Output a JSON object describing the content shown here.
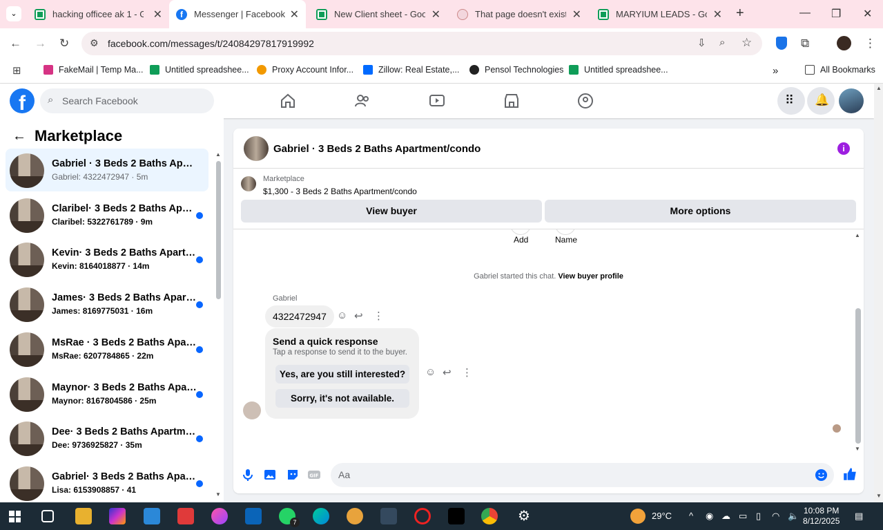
{
  "browser": {
    "tabs": [
      {
        "title": "hacking officee ak 1 - Go",
        "icon": "sheets-icon"
      },
      {
        "title": "Messenger | Facebook",
        "icon": "facebook-icon",
        "active": true
      },
      {
        "title": "New Client sheet - Googl",
        "icon": "sheets-icon"
      },
      {
        "title": "That page doesn't exist (",
        "icon": "page-icon"
      },
      {
        "title": "MARYIUM LEADS - Goog",
        "icon": "sheets-icon"
      }
    ],
    "url": "facebook.com/messages/t/24084297817919992",
    "bookmarks": [
      {
        "label": "FakeMail | Temp Ma...",
        "icon": "fakemail-icon"
      },
      {
        "label": "Untitled spreadshee...",
        "icon": "sheets-icon"
      },
      {
        "label": "Proxy Account Infor...",
        "icon": "proxy-icon"
      },
      {
        "label": "Zillow: Real Estate,...",
        "icon": "zillow-icon"
      },
      {
        "label": "Pensol Technologies",
        "icon": "pensol-icon"
      },
      {
        "label": "Untitled spreadshee...",
        "icon": "sheets-icon"
      }
    ],
    "all_bookmarks": "All Bookmarks",
    "more_bookmarks": "»"
  },
  "facebook": {
    "search_placeholder": "Search Facebook",
    "logo_letter": "f"
  },
  "sidebar": {
    "title": "Marketplace",
    "conversations": [
      {
        "name": "Gabriel · 3 Beds 2 Baths Apartm...",
        "preview": "Gabriel: 4322472947 · 5m",
        "unread": false,
        "selected": true
      },
      {
        "name": "Claribel· 3 Beds 2 Baths Apart...",
        "preview": "Claribel: 5322761789 · 9m",
        "unread": true
      },
      {
        "name": "Kevin· 3 Beds 2 Baths Apartm...",
        "preview": "Kevin: 8164018877 · 14m",
        "unread": true
      },
      {
        "name": "James· 3 Beds 2 Baths Apartm...",
        "preview": "James: 8169775031 · 16m",
        "unread": true
      },
      {
        "name": "MsRae · 3 Beds 2 Baths Apart...",
        "preview": "MsRae: 6207784865 · 22m",
        "unread": true
      },
      {
        "name": "Maynor· 3 Beds 2 Baths Apart...",
        "preview": "Maynor: 8167804586 · 25m",
        "unread": true
      },
      {
        "name": "Dee· 3 Beds 2 Baths Apartmen...",
        "preview": "Dee: 9736925827 · 35m",
        "unread": true
      },
      {
        "name": "Gabriel· 3 Beds 2 Baths Apart...",
        "preview": "Lisa: 6153908857 · 41",
        "unread": true
      }
    ]
  },
  "chat": {
    "title": "Gabriel · 3 Beds 2 Baths Apartment/condo",
    "listing_label": "Marketplace",
    "listing_price": "$1,300 - 3 Beds 2 Baths Apartment/condo",
    "view_buyer": "View buyer",
    "more_options": "More options",
    "add_label": "Add",
    "name_label": "Name",
    "started_text": "Gabriel started this chat.",
    "view_profile": "View buyer profile",
    "sender": "Gabriel",
    "message": "4322472947",
    "quick_title": "Send a quick response",
    "quick_sub": "Tap a response to send it to the buyer.",
    "quick_1": "Yes, are you still interested?",
    "quick_2": "Sorry, it's not available.",
    "input_placeholder": "Aa"
  },
  "taskbar": {
    "temperature": "29°C",
    "time": "10:08 PM",
    "date": "8/12/2025",
    "whatsapp_badge": "7"
  }
}
